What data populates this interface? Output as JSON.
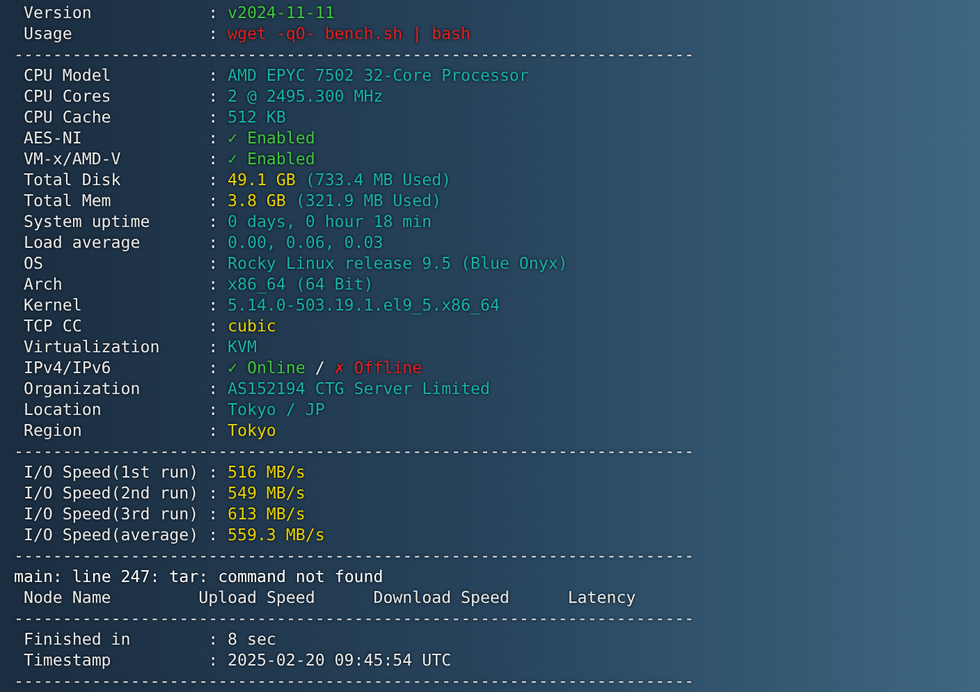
{
  "terminal": {
    "lines": [
      {
        "kind": "field",
        "label": "Version",
        "colon": ":",
        "value": [
          {
            "text": "v2024-11-11",
            "color": "#3ec43e"
          }
        ]
      },
      {
        "kind": "field",
        "label": "Usage",
        "colon": ":",
        "value": [
          {
            "text": "wget -qO- bench.sh | bash",
            "color": "#e02020"
          }
        ]
      },
      {
        "kind": "separator",
        "text": "----------------------------------------------------------------------"
      },
      {
        "kind": "field",
        "label": "CPU Model",
        "colon": ":",
        "value": [
          {
            "text": "AMD EPYC 7502 32-Core Processor",
            "color": "#16b0a8"
          }
        ]
      },
      {
        "kind": "field",
        "label": "CPU Cores",
        "colon": ":",
        "value": [
          {
            "text": "2 @ 2495.300 MHz",
            "color": "#16b0a8"
          }
        ]
      },
      {
        "kind": "field",
        "label": "CPU Cache",
        "colon": ":",
        "value": [
          {
            "text": "512 KB",
            "color": "#16b0a8"
          }
        ]
      },
      {
        "kind": "field",
        "label": "AES-NI",
        "colon": ":",
        "value": [
          {
            "text": "✓ Enabled",
            "color": "#3ec43e"
          }
        ]
      },
      {
        "kind": "field",
        "label": "VM-x/AMD-V",
        "colon": ":",
        "value": [
          {
            "text": "✓ Enabled",
            "color": "#3ec43e"
          }
        ]
      },
      {
        "kind": "field",
        "label": "Total Disk",
        "colon": ":",
        "value": [
          {
            "text": "49.1 GB",
            "color": "#e8d000"
          },
          {
            "text": " (733.4 MB Used)",
            "color": "#16b0a8"
          }
        ]
      },
      {
        "kind": "field",
        "label": "Total Mem",
        "colon": ":",
        "value": [
          {
            "text": "3.8 GB",
            "color": "#e8d000"
          },
          {
            "text": " (321.9 MB Used)",
            "color": "#16b0a8"
          }
        ]
      },
      {
        "kind": "field",
        "label": "System uptime",
        "colon": ":",
        "value": [
          {
            "text": "0 days, 0 hour 18 min",
            "color": "#16b0a8"
          }
        ]
      },
      {
        "kind": "field",
        "label": "Load average",
        "colon": ":",
        "value": [
          {
            "text": "0.00, 0.06, 0.03",
            "color": "#16b0a8"
          }
        ]
      },
      {
        "kind": "field",
        "label": "OS",
        "colon": ":",
        "value": [
          {
            "text": "Rocky Linux release 9.5 (Blue Onyx)",
            "color": "#16b0a8"
          }
        ]
      },
      {
        "kind": "field",
        "label": "Arch",
        "colon": ":",
        "value": [
          {
            "text": "x86_64 (64 Bit)",
            "color": "#16b0a8"
          }
        ]
      },
      {
        "kind": "field",
        "label": "Kernel",
        "colon": ":",
        "value": [
          {
            "text": "5.14.0-503.19.1.el9_5.x86_64",
            "color": "#16b0a8"
          }
        ]
      },
      {
        "kind": "field",
        "label": "TCP CC",
        "colon": ":",
        "value": [
          {
            "text": "cubic",
            "color": "#e8d000"
          }
        ]
      },
      {
        "kind": "field",
        "label": "Virtualization",
        "colon": ":",
        "value": [
          {
            "text": "KVM",
            "color": "#16b0a8"
          }
        ]
      },
      {
        "kind": "field",
        "label": "IPv4/IPv6",
        "colon": ":",
        "value": [
          {
            "text": "✓ Online",
            "color": "#3ec43e"
          },
          {
            "text": " / ",
            "color": "#e8e8e8"
          },
          {
            "text": "✗ Offline",
            "color": "#e02020"
          }
        ]
      },
      {
        "kind": "field",
        "label": "Organization",
        "colon": ":",
        "value": [
          {
            "text": "AS152194 CTG Server Limited",
            "color": "#16b0a8"
          }
        ]
      },
      {
        "kind": "field",
        "label": "Location",
        "colon": ":",
        "value": [
          {
            "text": "Tokyo / JP",
            "color": "#16b0a8"
          }
        ]
      },
      {
        "kind": "field",
        "label": "Region",
        "colon": ":",
        "value": [
          {
            "text": "Tokyo",
            "color": "#e8d000"
          }
        ]
      },
      {
        "kind": "separator",
        "text": "----------------------------------------------------------------------"
      },
      {
        "kind": "field",
        "label": "I/O Speed(1st run)",
        "colon": ":",
        "value": [
          {
            "text": "516 MB/s",
            "color": "#e8d000"
          }
        ]
      },
      {
        "kind": "field",
        "label": "I/O Speed(2nd run)",
        "colon": ":",
        "value": [
          {
            "text": "549 MB/s",
            "color": "#e8d000"
          }
        ]
      },
      {
        "kind": "field",
        "label": "I/O Speed(3rd run)",
        "colon": ":",
        "value": [
          {
            "text": "613 MB/s",
            "color": "#e8d000"
          }
        ]
      },
      {
        "kind": "field",
        "label": "I/O Speed(average)",
        "colon": ":",
        "value": [
          {
            "text": "559.3 MB/s",
            "color": "#e8d000"
          }
        ]
      },
      {
        "kind": "separator",
        "text": "----------------------------------------------------------------------"
      },
      {
        "kind": "plain",
        "text": "main: line 247: tar: command not found"
      },
      {
        "kind": "header",
        "columns": [
          "Node Name",
          "Upload Speed",
          "Download Speed",
          "Latency"
        ]
      },
      {
        "kind": "separator",
        "text": "----------------------------------------------------------------------"
      },
      {
        "kind": "field",
        "label": "Finished in",
        "colon": ":",
        "value": [
          {
            "text": "8 sec",
            "color": "#e8e8e8"
          }
        ]
      },
      {
        "kind": "field",
        "label": "Timestamp",
        "colon": ":",
        "value": [
          {
            "text": "2025-02-20 09:45:54 UTC",
            "color": "#e8e8e8"
          }
        ]
      },
      {
        "kind": "separator",
        "text": "----------------------------------------------------------------------"
      }
    ]
  }
}
